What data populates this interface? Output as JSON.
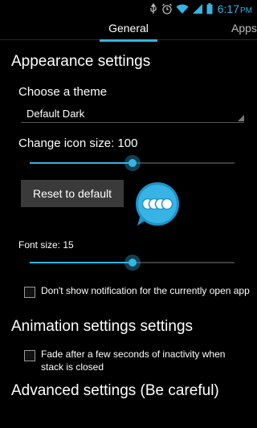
{
  "status_bar": {
    "time": "6:17",
    "ampm": "PM",
    "icons": [
      "usb-icon",
      "alarm-icon",
      "wifi-icon",
      "signal-icon",
      "battery-icon"
    ]
  },
  "tabs": {
    "general": "General",
    "apps": "Apps"
  },
  "appearance": {
    "title": "Appearance settings",
    "theme_label": "Choose a theme",
    "theme_value": "Default Dark",
    "icon_size_label": "Change icon size: 100",
    "icon_size_value": 100,
    "icon_size_fraction": 0.5,
    "reset_button": "Reset to default",
    "font_size_label": "Font size: 15",
    "font_size_value": 15,
    "font_size_fraction": 0.5,
    "notification_checkbox": "Don't show notification for the currently open app",
    "notification_checked": false
  },
  "animation": {
    "title": "Animation settings settings",
    "fade_checkbox": "Fade after a few seconds of inactivity when stack is closed",
    "fade_checked": false
  },
  "advanced": {
    "title": "Advanced settings (Be careful)"
  },
  "colors": {
    "accent": "#33b5e5",
    "background": "#000000",
    "button": "#3a3a3a"
  }
}
